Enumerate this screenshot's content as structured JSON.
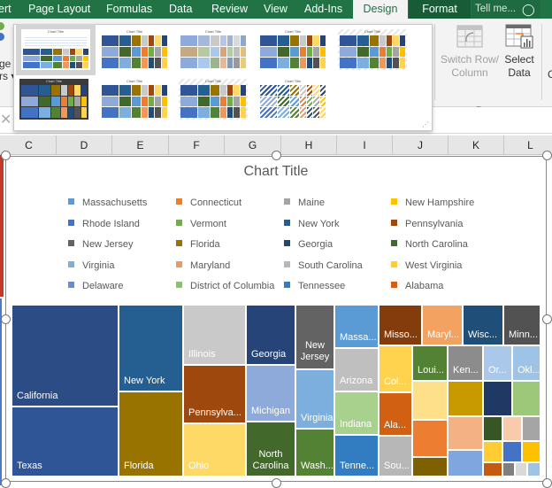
{
  "ribbon": {
    "tabs": [
      {
        "label": "ert",
        "x": 0
      },
      {
        "label": "Page Layout"
      },
      {
        "label": "Formulas"
      },
      {
        "label": "Data"
      },
      {
        "label": "Review"
      },
      {
        "label": "View"
      },
      {
        "label": "Add-Ins"
      },
      {
        "label": "Design",
        "active": true
      },
      {
        "label": "Format"
      },
      {
        "label": "Tell me..."
      }
    ],
    "left_partial": {
      "line1": "ge",
      "line2": "rs ▾"
    },
    "data_group": {
      "switch_row_column": {
        "line1": "Switch Row/",
        "line2": "Column"
      },
      "select_data": {
        "line1": "Select",
        "line2": "Data"
      },
      "label": "Data"
    },
    "right_partial": "C"
  },
  "gallery": {
    "thumb_title": "Chart Title",
    "styles_count": 9,
    "selected_index": 0
  },
  "columns": [
    "C",
    "D",
    "E",
    "F",
    "G",
    "H",
    "I",
    "J",
    "K",
    "L"
  ],
  "chart": {
    "title": "Chart Title",
    "legend": [
      {
        "label": "Massachusetts",
        "color": "#5b9bd5"
      },
      {
        "label": "Connecticut",
        "color": "#ed7d31"
      },
      {
        "label": "Maine",
        "color": "#a5a5a5"
      },
      {
        "label": "New Hampshire",
        "color": "#ffc000"
      },
      {
        "label": "Rhode Island",
        "color": "#4472c4"
      },
      {
        "label": "Vermont",
        "color": "#70ad47"
      },
      {
        "label": "New York",
        "color": "#255e91"
      },
      {
        "label": "Pennsylvania",
        "color": "#9e480e"
      },
      {
        "label": "New Jersey",
        "color": "#636363"
      },
      {
        "label": "Florida",
        "color": "#997300"
      },
      {
        "label": "Georgia",
        "color": "#264478"
      },
      {
        "label": "North Carolina",
        "color": "#43682b"
      },
      {
        "label": "Virginia",
        "color": "#7cafdd"
      },
      {
        "label": "Maryland",
        "color": "#f1975a"
      },
      {
        "label": "South Carolina",
        "color": "#b7b7b7"
      },
      {
        "label": "West Virginia",
        "color": "#ffcd33"
      },
      {
        "label": "Delaware",
        "color": "#698ed0"
      },
      {
        "label": "District of Columbia",
        "color": "#8cc168"
      },
      {
        "label": "Tennessee",
        "color": "#327dc2"
      },
      {
        "label": "Alabama",
        "color": "#d26012"
      }
    ],
    "tiles": [
      {
        "label": "California",
        "color": "#2c4c86"
      },
      {
        "label": "Texas",
        "color": "#2f5597"
      },
      {
        "label": "New York",
        "color": "#255e91"
      },
      {
        "label": "Florida",
        "color": "#997300"
      },
      {
        "label": "Illinois",
        "color": "#c9c9c9"
      },
      {
        "label": "Pennsylva...",
        "color": "#9e480e"
      },
      {
        "label": "Ohio",
        "color": "#ffd966"
      },
      {
        "label": "Georgia",
        "color": "#264478"
      },
      {
        "label": "Michigan",
        "color": "#8eaadb"
      },
      {
        "label": "North Carolina",
        "color": "#43682b"
      },
      {
        "label": "New Jersey",
        "color": "#636363"
      },
      {
        "label": "Virginia",
        "color": "#7cafdd"
      },
      {
        "label": "Wash...",
        "color": "#548235"
      },
      {
        "label": "Massa...",
        "color": "#5b9bd5"
      },
      {
        "label": "Arizona",
        "color": "#bfbfbf"
      },
      {
        "label": "Indiana",
        "color": "#a9d18e"
      },
      {
        "label": "Tenne...",
        "color": "#327dc2"
      },
      {
        "label": "Misso...",
        "color": "#843c0c"
      },
      {
        "label": "Maryl...",
        "color": "#f4a261"
      },
      {
        "label": "Wisc...",
        "color": "#1f4e79"
      },
      {
        "label": "Minn...",
        "color": "#525252"
      },
      {
        "label": "Col...",
        "color": "#ffd34d"
      },
      {
        "label": "Ala...",
        "color": "#d26012"
      },
      {
        "label": "Sou...",
        "color": "#b7b7b7"
      },
      {
        "label": "Loui...",
        "color": "#548235"
      },
      {
        "label": "Ken...",
        "color": "#8c8c8c"
      },
      {
        "label": "Or...",
        "color": "#a9c8ea"
      },
      {
        "label": "Okl...",
        "color": "#9dc3e6"
      }
    ]
  }
}
